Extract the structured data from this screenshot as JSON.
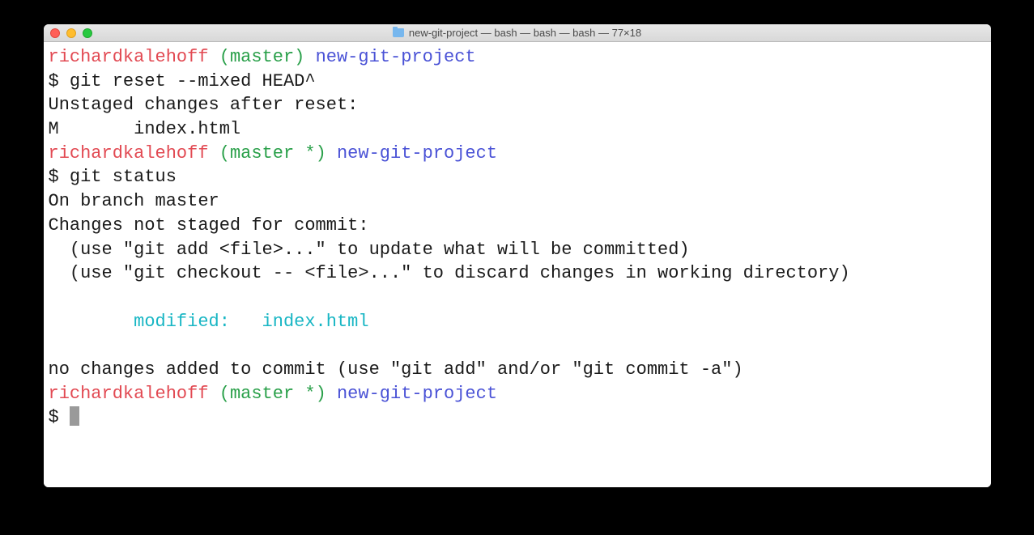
{
  "window": {
    "title": "new-git-project — bash — bash — bash — 77×18"
  },
  "prompt1": {
    "user": "richardkalehoff",
    "branch": "(master)",
    "dir": "new-git-project",
    "symbol": "$ ",
    "command": "git reset --mixed HEAD^"
  },
  "out1": {
    "line1": "Unstaged changes after reset:",
    "line2": "M       index.html"
  },
  "prompt2": {
    "user": "richardkalehoff",
    "branch": "(master *)",
    "dir": "new-git-project",
    "symbol": "$ ",
    "command": "git status"
  },
  "out2": {
    "line1": "On branch master",
    "line2": "Changes not staged for commit:",
    "line3": "  (use \"git add <file>...\" to update what will be committed)",
    "line4": "  (use \"git checkout -- <file>...\" to discard changes in working directory)",
    "blank": "",
    "modified": "        modified:   index.html",
    "blank2": "",
    "line5": "no changes added to commit (use \"git add\" and/or \"git commit -a\")"
  },
  "prompt3": {
    "user": "richardkalehoff",
    "branch": "(master *)",
    "dir": "new-git-project",
    "symbol": "$ "
  }
}
